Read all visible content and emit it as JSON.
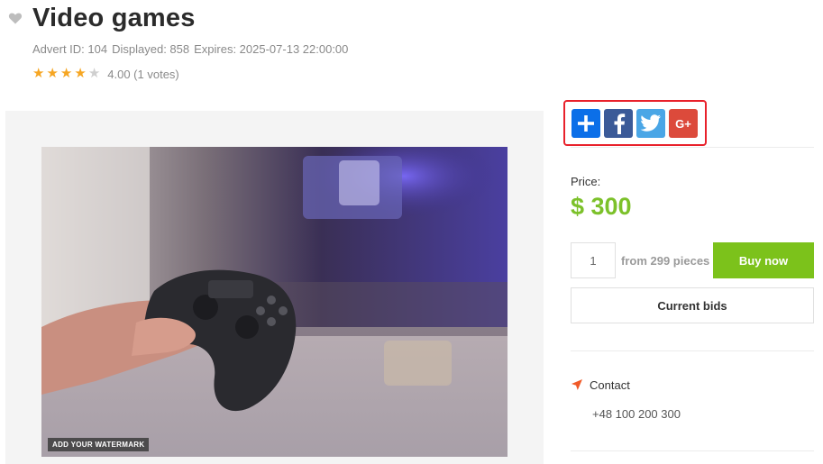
{
  "ad": {
    "title": "Video games",
    "advert_id": "Advert ID: 104",
    "displayed": "Displayed: 858",
    "expires": "Expires: 2025-07-13 22:00:00",
    "rating_stars": 4,
    "rating_max": 5,
    "rating_text": "4.00 (1 votes)"
  },
  "gallery": {
    "watermark": "ADD YOUR WATERMARK"
  },
  "share": {
    "buttons": [
      "plus-icon",
      "facebook-icon",
      "twitter-icon",
      "google-plus-icon"
    ],
    "google_plus_label": "G+"
  },
  "purchase": {
    "price_label": "Price:",
    "price": "$ 300",
    "quantity": "1",
    "pieces": "from 299 pieces",
    "buy_label": "Buy now",
    "bids_label": "Current bids"
  },
  "contact": {
    "label": "Contact",
    "phone": "+48 100 200 300"
  },
  "colors": {
    "accent_green": "#7cc21b",
    "highlight_red": "#e8212b",
    "facebook": "#3b5a98",
    "twitter": "#4aa6e6",
    "google_plus": "#dc4a3b",
    "plus": "#0b6fe8",
    "star": "#f6a623"
  }
}
